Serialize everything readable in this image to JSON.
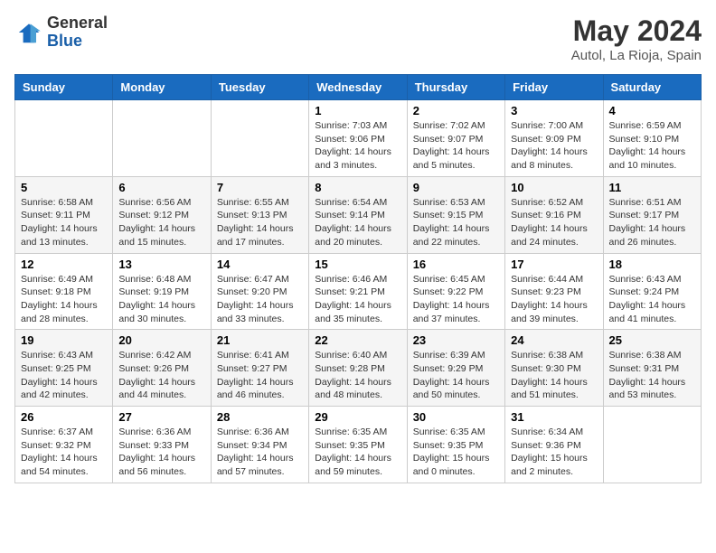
{
  "header": {
    "logo_general": "General",
    "logo_blue": "Blue",
    "month_title": "May 2024",
    "location": "Autol, La Rioja, Spain"
  },
  "days_of_week": [
    "Sunday",
    "Monday",
    "Tuesday",
    "Wednesday",
    "Thursday",
    "Friday",
    "Saturday"
  ],
  "weeks": [
    [
      {
        "day": "",
        "info": ""
      },
      {
        "day": "",
        "info": ""
      },
      {
        "day": "",
        "info": ""
      },
      {
        "day": "1",
        "info": "Sunrise: 7:03 AM\nSunset: 9:06 PM\nDaylight: 14 hours\nand 3 minutes."
      },
      {
        "day": "2",
        "info": "Sunrise: 7:02 AM\nSunset: 9:07 PM\nDaylight: 14 hours\nand 5 minutes."
      },
      {
        "day": "3",
        "info": "Sunrise: 7:00 AM\nSunset: 9:09 PM\nDaylight: 14 hours\nand 8 minutes."
      },
      {
        "day": "4",
        "info": "Sunrise: 6:59 AM\nSunset: 9:10 PM\nDaylight: 14 hours\nand 10 minutes."
      }
    ],
    [
      {
        "day": "5",
        "info": "Sunrise: 6:58 AM\nSunset: 9:11 PM\nDaylight: 14 hours\nand 13 minutes."
      },
      {
        "day": "6",
        "info": "Sunrise: 6:56 AM\nSunset: 9:12 PM\nDaylight: 14 hours\nand 15 minutes."
      },
      {
        "day": "7",
        "info": "Sunrise: 6:55 AM\nSunset: 9:13 PM\nDaylight: 14 hours\nand 17 minutes."
      },
      {
        "day": "8",
        "info": "Sunrise: 6:54 AM\nSunset: 9:14 PM\nDaylight: 14 hours\nand 20 minutes."
      },
      {
        "day": "9",
        "info": "Sunrise: 6:53 AM\nSunset: 9:15 PM\nDaylight: 14 hours\nand 22 minutes."
      },
      {
        "day": "10",
        "info": "Sunrise: 6:52 AM\nSunset: 9:16 PM\nDaylight: 14 hours\nand 24 minutes."
      },
      {
        "day": "11",
        "info": "Sunrise: 6:51 AM\nSunset: 9:17 PM\nDaylight: 14 hours\nand 26 minutes."
      }
    ],
    [
      {
        "day": "12",
        "info": "Sunrise: 6:49 AM\nSunset: 9:18 PM\nDaylight: 14 hours\nand 28 minutes."
      },
      {
        "day": "13",
        "info": "Sunrise: 6:48 AM\nSunset: 9:19 PM\nDaylight: 14 hours\nand 30 minutes."
      },
      {
        "day": "14",
        "info": "Sunrise: 6:47 AM\nSunset: 9:20 PM\nDaylight: 14 hours\nand 33 minutes."
      },
      {
        "day": "15",
        "info": "Sunrise: 6:46 AM\nSunset: 9:21 PM\nDaylight: 14 hours\nand 35 minutes."
      },
      {
        "day": "16",
        "info": "Sunrise: 6:45 AM\nSunset: 9:22 PM\nDaylight: 14 hours\nand 37 minutes."
      },
      {
        "day": "17",
        "info": "Sunrise: 6:44 AM\nSunset: 9:23 PM\nDaylight: 14 hours\nand 39 minutes."
      },
      {
        "day": "18",
        "info": "Sunrise: 6:43 AM\nSunset: 9:24 PM\nDaylight: 14 hours\nand 41 minutes."
      }
    ],
    [
      {
        "day": "19",
        "info": "Sunrise: 6:43 AM\nSunset: 9:25 PM\nDaylight: 14 hours\nand 42 minutes."
      },
      {
        "day": "20",
        "info": "Sunrise: 6:42 AM\nSunset: 9:26 PM\nDaylight: 14 hours\nand 44 minutes."
      },
      {
        "day": "21",
        "info": "Sunrise: 6:41 AM\nSunset: 9:27 PM\nDaylight: 14 hours\nand 46 minutes."
      },
      {
        "day": "22",
        "info": "Sunrise: 6:40 AM\nSunset: 9:28 PM\nDaylight: 14 hours\nand 48 minutes."
      },
      {
        "day": "23",
        "info": "Sunrise: 6:39 AM\nSunset: 9:29 PM\nDaylight: 14 hours\nand 50 minutes."
      },
      {
        "day": "24",
        "info": "Sunrise: 6:38 AM\nSunset: 9:30 PM\nDaylight: 14 hours\nand 51 minutes."
      },
      {
        "day": "25",
        "info": "Sunrise: 6:38 AM\nSunset: 9:31 PM\nDaylight: 14 hours\nand 53 minutes."
      }
    ],
    [
      {
        "day": "26",
        "info": "Sunrise: 6:37 AM\nSunset: 9:32 PM\nDaylight: 14 hours\nand 54 minutes."
      },
      {
        "day": "27",
        "info": "Sunrise: 6:36 AM\nSunset: 9:33 PM\nDaylight: 14 hours\nand 56 minutes."
      },
      {
        "day": "28",
        "info": "Sunrise: 6:36 AM\nSunset: 9:34 PM\nDaylight: 14 hours\nand 57 minutes."
      },
      {
        "day": "29",
        "info": "Sunrise: 6:35 AM\nSunset: 9:35 PM\nDaylight: 14 hours\nand 59 minutes."
      },
      {
        "day": "30",
        "info": "Sunrise: 6:35 AM\nSunset: 9:35 PM\nDaylight: 15 hours\nand 0 minutes."
      },
      {
        "day": "31",
        "info": "Sunrise: 6:34 AM\nSunset: 9:36 PM\nDaylight: 15 hours\nand 2 minutes."
      },
      {
        "day": "",
        "info": ""
      }
    ]
  ]
}
